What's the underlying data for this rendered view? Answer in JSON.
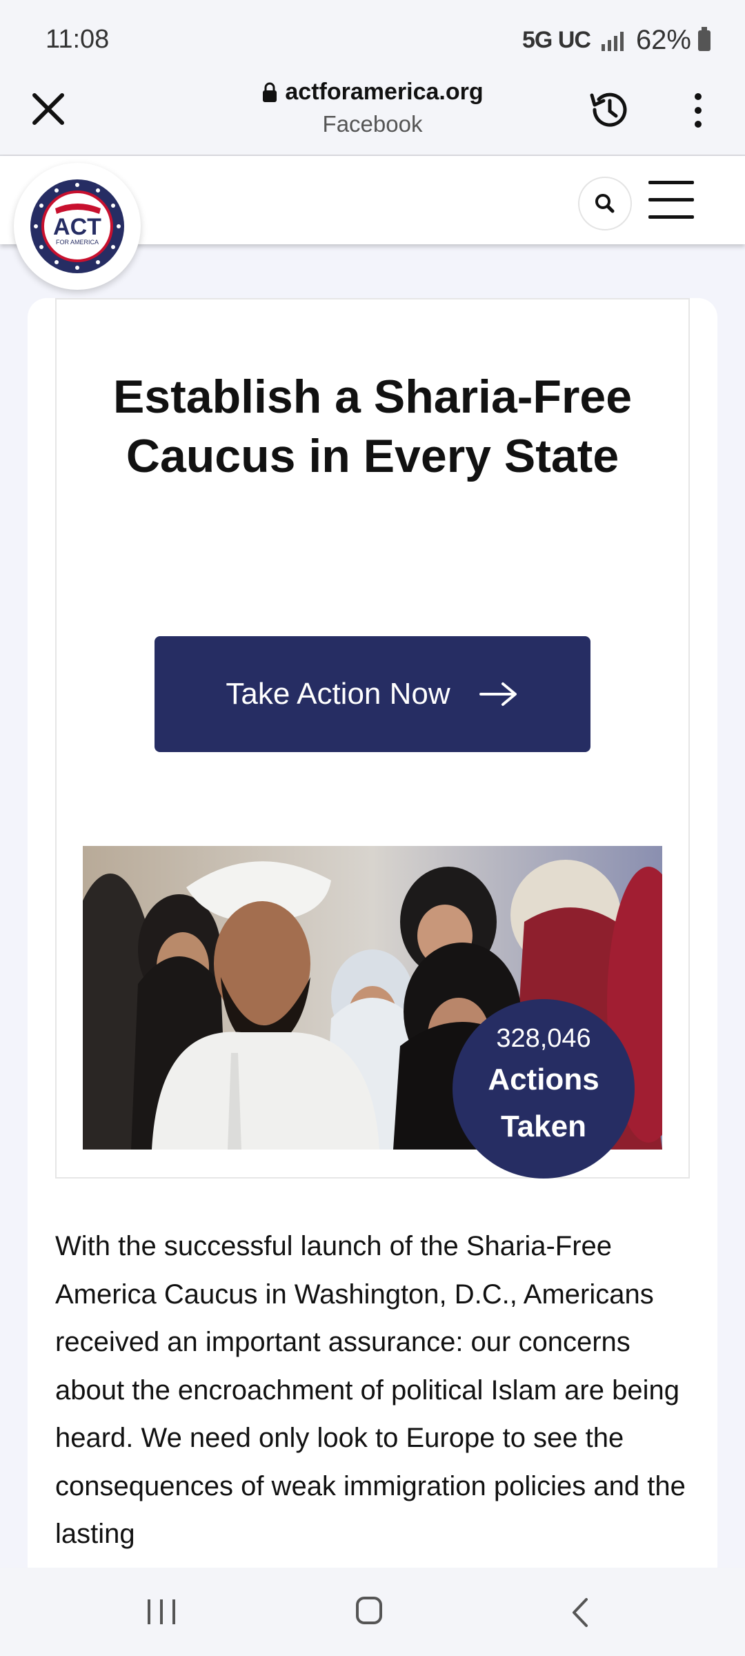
{
  "status_bar": {
    "time": "11:08",
    "network": "5G UC",
    "battery": "62%"
  },
  "browser": {
    "domain": "actforamerica.org",
    "subtitle": "Facebook",
    "icons": [
      "close-icon",
      "lock-icon",
      "history-icon",
      "more-vert-icon"
    ]
  },
  "site": {
    "logo_main": "ACT",
    "logo_sub": "FOR AMERICA",
    "icons": [
      "search-icon",
      "hamburger-menu-icon"
    ]
  },
  "campaign": {
    "title": "Establish a Sharia-Free Caucus in Every State",
    "cta_label": "Take Action Now",
    "actions_count": "328,046",
    "actions_label": "Actions Taken",
    "body_text": "With the successful launch of the Sharia-Free America Caucus in Washington, D.C., Americans received an important assurance: our concerns about the encroachment of political Islam are being heard. We need only look to Europe to see the consequences of weak immigration policies and the lasting"
  },
  "colors": {
    "brand_navy": "#262d63",
    "page_bg": "#f3f4fb"
  },
  "nav_bar": {
    "icons": [
      "recent-apps-icon",
      "home-icon",
      "back-icon"
    ]
  }
}
